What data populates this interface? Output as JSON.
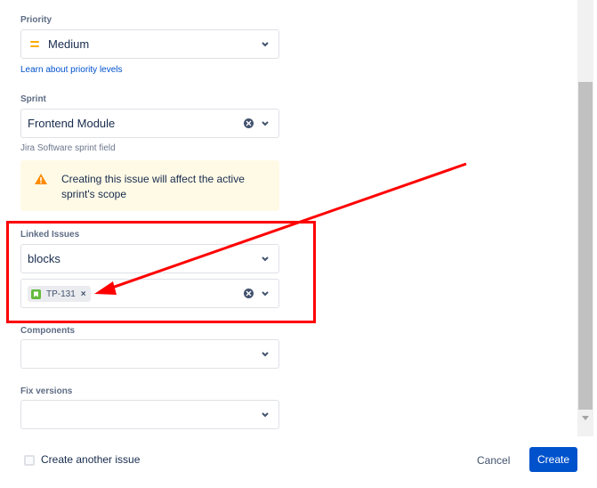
{
  "priority": {
    "label": "Priority",
    "value": "Medium",
    "help_link": "Learn about priority levels",
    "icon": "priority-medium-icon"
  },
  "sprint": {
    "label": "Sprint",
    "value": "Frontend Module",
    "helper": "Jira Software sprint field",
    "warning": "Creating this issue will affect the active sprint's scope"
  },
  "linked_issues": {
    "label": "Linked Issues",
    "link_type": "blocks",
    "issue_key": "TP-131",
    "remove_glyph": "×"
  },
  "components": {
    "label": "Components",
    "value": ""
  },
  "fix_versions": {
    "label": "Fix versions",
    "value": ""
  },
  "footer": {
    "create_another_label": "Create another issue",
    "cancel_label": "Cancel",
    "create_label": "Create"
  },
  "colors": {
    "annotation": "#ff0000",
    "primary": "#0052cc",
    "warning_bg": "#fffae6",
    "story": "#63ba3c",
    "priority_medium": "#ffab00"
  }
}
